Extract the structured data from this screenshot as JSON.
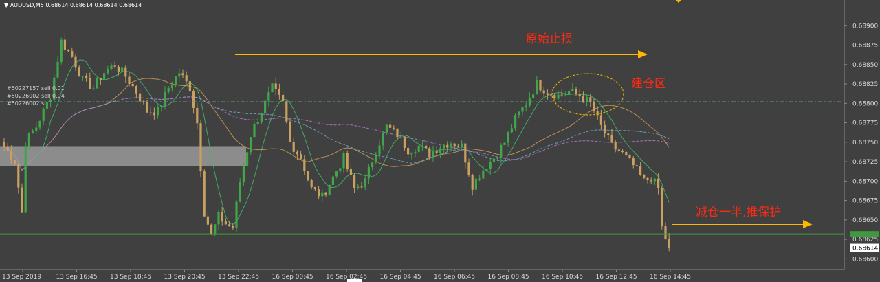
{
  "chart_data": {
    "type": "candlestick",
    "symbol_header": "AUDUSD,M5",
    "ohlc_readout": "0.68614 0.68614 0.68614 0.68614",
    "y_ticks": [
      "0.68900",
      "0.68875",
      "0.68850",
      "0.68825",
      "0.68800",
      "0.68775",
      "0.68750",
      "0.68725",
      "0.68700",
      "0.68675",
      "0.68650",
      "0.68625",
      "0.68600"
    ],
    "ylim": [
      0.68595,
      0.6891
    ],
    "current_price": "0.68614",
    "right_marker_price": "0.68632",
    "x_tick_labels": [
      "13 Sep 2019",
      "13 Sep 16:45",
      "13 Sep 18:45",
      "13 Sep 20:45",
      "13 Sep 22:45",
      "16 Sep 00:45",
      "16 Sep 02:45",
      "16 Sep 04:45",
      "16 Sep 06:45",
      "16 Sep 08:45",
      "16 Sep 10:45",
      "16 Sep 12:45",
      "16 Sep 14:45"
    ],
    "order_lines": [
      {
        "label": "#50227157 sell 0.01",
        "price": 0.68802
      },
      {
        "label": "#50226002 sell 0.04",
        "price": 0.68802
      },
      {
        "label": "#50226002 sl",
        "price": 0.68802
      }
    ],
    "close_path": [
      [
        0,
        0.68745
      ],
      [
        3,
        0.68725
      ],
      [
        5,
        0.6866
      ],
      [
        6,
        0.6875
      ],
      [
        9,
        0.6877
      ],
      [
        13,
        0.6881
      ],
      [
        16,
        0.6888
      ],
      [
        19,
        0.6886
      ],
      [
        22,
        0.6883
      ],
      [
        25,
        0.6882
      ],
      [
        28,
        0.6884
      ],
      [
        31,
        0.6885
      ],
      [
        34,
        0.68835
      ],
      [
        37,
        0.68815
      ],
      [
        40,
        0.6879
      ],
      [
        43,
        0.6879
      ],
      [
        46,
        0.6882
      ],
      [
        49,
        0.6884
      ],
      [
        52,
        0.6882
      ],
      [
        54,
        0.68775
      ],
      [
        56,
        0.6866
      ],
      [
        58,
        0.6863
      ],
      [
        60,
        0.68655
      ],
      [
        62,
        0.68645
      ],
      [
        64,
        0.6864
      ],
      [
        66,
        0.687
      ],
      [
        69,
        0.6876
      ],
      [
        72,
        0.6879
      ],
      [
        75,
        0.6882
      ],
      [
        78,
        0.688
      ],
      [
        80,
        0.6875
      ],
      [
        83,
        0.6873
      ],
      [
        86,
        0.6869
      ],
      [
        89,
        0.6868
      ],
      [
        92,
        0.68705
      ],
      [
        95,
        0.6873
      ],
      [
        98,
        0.6869
      ],
      [
        101,
        0.687
      ],
      [
        104,
        0.6874
      ],
      [
        107,
        0.6877
      ],
      [
        110,
        0.6876
      ],
      [
        113,
        0.6874
      ],
      [
        116,
        0.68745
      ],
      [
        119,
        0.68735
      ],
      [
        122,
        0.68745
      ],
      [
        125,
        0.6875
      ],
      [
        128,
        0.68745
      ],
      [
        131,
        0.68695
      ],
      [
        134,
        0.68715
      ],
      [
        137,
        0.6873
      ],
      [
        140,
        0.6875
      ],
      [
        143,
        0.6878
      ],
      [
        146,
        0.688
      ],
      [
        149,
        0.68825
      ],
      [
        152,
        0.68815
      ],
      [
        155,
        0.6881
      ],
      [
        158,
        0.68815
      ],
      [
        161,
        0.6881
      ],
      [
        164,
        0.688
      ],
      [
        167,
        0.6877
      ],
      [
        170,
        0.68745
      ],
      [
        173,
        0.68735
      ],
      [
        176,
        0.6872
      ],
      [
        179,
        0.687
      ],
      [
        181,
        0.68705
      ],
      [
        183,
        0.6869
      ],
      [
        184,
        0.6864
      ],
      [
        186,
        0.68614
      ]
    ],
    "annotations": [
      {
        "text": "原始止损",
        "price": 0.68875
      },
      {
        "text": "建仓区",
        "price": 0.6881
      },
      {
        "text": "减仓一半,推保护",
        "price": 0.68643
      }
    ],
    "moving_averages": [
      {
        "color": "#3fb86a"
      },
      {
        "color": "#c99a55"
      },
      {
        "color": "#6fa8c8"
      },
      {
        "color": "#b07ac8"
      }
    ],
    "colors": {
      "background": "#404040",
      "bull": "#3fa64a",
      "bear": "#c8a060",
      "annotation_text": "#ff2a14",
      "arrow": "#ffb800",
      "zone": "#9a9a9a",
      "ellipse": "#e0b000",
      "order_line": "#5aa08a",
      "price_line": "#3e9a3e"
    }
  }
}
